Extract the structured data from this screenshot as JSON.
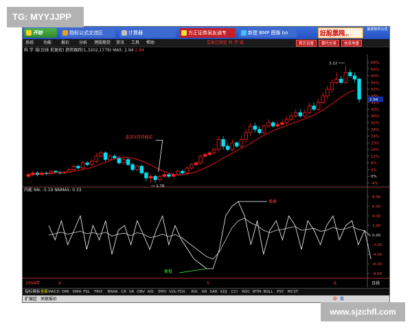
{
  "watermarks": {
    "top_left": "TG: MYYJJPP",
    "bottom_right": "www.sjzchfl.com"
  },
  "taskbar": {
    "start_label": "开始",
    "items": [
      {
        "label": "指标公式交流区"
      },
      {
        "label": "计算器"
      },
      {
        "label": "方正证券泉友通专"
      },
      {
        "label": "新建 BMP 图像 bo"
      }
    ],
    "logo_text": "好股票网",
    "logo_sub": "Goodgupiao.com",
    "tag_text": "股票软件公式"
  },
  "menubar": {
    "items": [
      "系统",
      "功能",
      "报价",
      "分析",
      "港股期货",
      "资讯",
      "工具",
      "帮助"
    ],
    "center_text": "交易已锁定  科 学 城",
    "buttons": [
      "首页设置",
      "委托交易",
      "信息地雷"
    ]
  },
  "chart_title": {
    "stock": "科 学 城(日线 前复权) 趋势跟踪(1,3202,1779)",
    "ma_label": "MA5: 2.94",
    "ma_value": "2.94"
  },
  "main_chart": {
    "axis_right": [
      "68%",
      "64%",
      "60%",
      "56%",
      "52%",
      "48%",
      "44%",
      "40%",
      "36%",
      "32%",
      "28%",
      "24%",
      "20%",
      "16%",
      "12%",
      "8%",
      "4%",
      "0%",
      "-4%"
    ],
    "annotations": {
      "high": "3.22",
      "low": "1.78",
      "current": "2.94",
      "callout": "金叉5日均线买"
    }
  },
  "indicator": {
    "title": "内能 NN: -5.19 NNMA5: 0.33",
    "axis": [
      "8.00",
      "6.00",
      "4.00",
      "2.00",
      "0.00",
      "-2.00",
      "-4.00",
      "-6.00",
      "-8.00"
    ],
    "top_label": "卖高",
    "bottom_label": "卖低"
  },
  "timeline": {
    "left": "2006年",
    "marks": [
      "4",
      "5",
      "6"
    ],
    "right_label": "日线"
  },
  "tabs": {
    "items": [
      "指标",
      "模板",
      "全部",
      "MACD",
      "DMI",
      "DMA",
      "FSL",
      "TRIX",
      "BRAR",
      "CR",
      "VR",
      "OBV",
      "ASI",
      "EMV",
      "VOL-TDX",
      "RSI",
      "KR",
      "SAR",
      "KDJ",
      "CCI",
      "ROC",
      "MTM",
      "BOLL",
      "PSY",
      "MCST"
    ]
  },
  "status": {
    "left": [
      "扩展区",
      "关联报价"
    ],
    "right": [
      "中",
      "英"
    ]
  },
  "colors": {
    "up": "#ff2020",
    "down": "#00e0f0",
    "ma": "#e81818",
    "line1": "#ffffff",
    "line2": "#d8d8d8",
    "annotation": "#ff4040",
    "green_label": "#40ff40"
  },
  "chart_data": [
    {
      "type": "candlestick",
      "title": "科 学 城(日线 前复权)",
      "y_axis": {
        "unit": "percent",
        "range": [
          -6,
          70
        ],
        "ticks": [
          68,
          64,
          60,
          56,
          52,
          48,
          44,
          40,
          36,
          32,
          28,
          24,
          20,
          16,
          12,
          8,
          4,
          0,
          -4
        ]
      },
      "candles": [
        {
          "o": 0,
          "c": 1,
          "h": 2,
          "l": -1
        },
        {
          "o": 1,
          "c": 2,
          "h": 3,
          "l": 0
        },
        {
          "o": 2,
          "c": 1,
          "h": 3,
          "l": 0
        },
        {
          "o": 1,
          "c": 2,
          "h": 3,
          "l": 0
        },
        {
          "o": 2,
          "c": 1.5,
          "h": 3,
          "l": 0.5
        },
        {
          "o": 1.5,
          "c": 3,
          "h": 4,
          "l": 1
        },
        {
          "o": 3,
          "c": 2.5,
          "h": 3.5,
          "l": 1.5
        },
        {
          "o": 2.5,
          "c": 2,
          "h": 3,
          "l": 1
        },
        {
          "o": 2,
          "c": 2.5,
          "h": 3,
          "l": 1.5
        },
        {
          "o": 2.5,
          "c": 4,
          "h": 5,
          "l": 2
        },
        {
          "o": 4,
          "c": 6,
          "h": 7,
          "l": 3
        },
        {
          "o": 6,
          "c": 5,
          "h": 7,
          "l": 4
        },
        {
          "o": 5,
          "c": 8,
          "h": 9,
          "l": 4
        },
        {
          "o": 8,
          "c": 7,
          "h": 9,
          "l": 6
        },
        {
          "o": 7,
          "c": 9,
          "h": 10,
          "l": 6
        },
        {
          "o": 9,
          "c": 12,
          "h": 14,
          "l": 8
        },
        {
          "o": 12,
          "c": 14,
          "h": 15,
          "l": 11
        },
        {
          "o": 14,
          "c": 10,
          "h": 15,
          "l": 9
        },
        {
          "o": 10,
          "c": 12,
          "h": 13,
          "l": 9
        },
        {
          "o": 12,
          "c": 11,
          "h": 13,
          "l": 10
        },
        {
          "o": 11,
          "c": 8,
          "h": 12,
          "l": 7
        },
        {
          "o": 8,
          "c": 10,
          "h": 11,
          "l": 7
        },
        {
          "o": 10,
          "c": 7,
          "h": 11,
          "l": 6
        },
        {
          "o": 7,
          "c": 4,
          "h": 8,
          "l": 3
        },
        {
          "o": 4,
          "c": 6,
          "h": 7,
          "l": 3
        },
        {
          "o": 6,
          "c": 2,
          "h": 7,
          "l": 1
        },
        {
          "o": 2,
          "c": -1,
          "h": 3,
          "l": -3
        },
        {
          "o": -1,
          "c": 0,
          "h": 1,
          "l": -4
        },
        {
          "o": 0,
          "c": -2,
          "h": 1,
          "l": -4
        },
        {
          "o": -2,
          "c": 0,
          "h": 1,
          "l": -3
        },
        {
          "o": 0,
          "c": 1,
          "h": 2,
          "l": -1
        },
        {
          "o": 1,
          "c": 0,
          "h": 2,
          "l": -1
        },
        {
          "o": 0,
          "c": 1,
          "h": 2,
          "l": -1
        },
        {
          "o": 1,
          "c": 3,
          "h": 4,
          "l": 0
        },
        {
          "o": 3,
          "c": 2,
          "h": 4,
          "l": 1
        },
        {
          "o": 2,
          "c": 5,
          "h": 6,
          "l": 1
        },
        {
          "o": 5,
          "c": 7,
          "h": 8,
          "l": 4
        },
        {
          "o": 7,
          "c": 8,
          "h": 9,
          "l": 6
        },
        {
          "o": 8,
          "c": 12,
          "h": 13,
          "l": 7
        },
        {
          "o": 12,
          "c": 13,
          "h": 14,
          "l": 11
        },
        {
          "o": 13,
          "c": 14,
          "h": 15,
          "l": 12
        },
        {
          "o": 14,
          "c": 16,
          "h": 17,
          "l": 13
        },
        {
          "o": 16,
          "c": 22,
          "h": 24,
          "l": 15
        },
        {
          "o": 22,
          "c": 18,
          "h": 24,
          "l": 16
        },
        {
          "o": 18,
          "c": 16,
          "h": 20,
          "l": 15
        },
        {
          "o": 16,
          "c": 20,
          "h": 22,
          "l": 15
        },
        {
          "o": 20,
          "c": 18,
          "h": 21,
          "l": 17
        },
        {
          "o": 18,
          "c": 22,
          "h": 24,
          "l": 17
        },
        {
          "o": 22,
          "c": 26,
          "h": 28,
          "l": 20
        },
        {
          "o": 26,
          "c": 30,
          "h": 32,
          "l": 24
        },
        {
          "o": 30,
          "c": 28,
          "h": 32,
          "l": 26
        },
        {
          "o": 28,
          "c": 26,
          "h": 30,
          "l": 25
        },
        {
          "o": 26,
          "c": 30,
          "h": 31,
          "l": 25
        },
        {
          "o": 30,
          "c": 32,
          "h": 34,
          "l": 29
        },
        {
          "o": 32,
          "c": 30,
          "h": 33,
          "l": 29
        },
        {
          "o": 30,
          "c": 31,
          "h": 33,
          "l": 29
        },
        {
          "o": 31,
          "c": 32,
          "h": 34,
          "l": 30
        },
        {
          "o": 32,
          "c": 34,
          "h": 36,
          "l": 31
        },
        {
          "o": 34,
          "c": 36,
          "h": 38,
          "l": 33
        },
        {
          "o": 36,
          "c": 38,
          "h": 40,
          "l": 35
        },
        {
          "o": 38,
          "c": 36,
          "h": 40,
          "l": 35
        },
        {
          "o": 36,
          "c": 38,
          "h": 40,
          "l": 35
        },
        {
          "o": 38,
          "c": 42,
          "h": 44,
          "l": 37
        },
        {
          "o": 42,
          "c": 40,
          "h": 44,
          "l": 39
        },
        {
          "o": 40,
          "c": 44,
          "h": 46,
          "l": 39
        },
        {
          "o": 44,
          "c": 48,
          "h": 50,
          "l": 43
        },
        {
          "o": 48,
          "c": 52,
          "h": 54,
          "l": 46
        },
        {
          "o": 52,
          "c": 56,
          "h": 58,
          "l": 50
        },
        {
          "o": 56,
          "c": 58,
          "h": 62,
          "l": 55
        },
        {
          "o": 58,
          "c": 56,
          "h": 60,
          "l": 55
        },
        {
          "o": 56,
          "c": 62,
          "h": 66,
          "l": 55
        },
        {
          "o": 62,
          "c": 60,
          "h": 64,
          "l": 59
        },
        {
          "o": 60,
          "c": 58,
          "h": 62,
          "l": 56
        },
        {
          "o": 58,
          "c": 46,
          "h": 59,
          "l": 44
        }
      ],
      "ma": [
        1,
        1.3,
        1.5,
        1.7,
        1.8,
        2,
        2.2,
        2.3,
        2.4,
        2.6,
        3,
        3.4,
        4,
        4.6,
        5.3,
        6.3,
        7.4,
        8.4,
        9.4,
        10.3,
        11,
        11.3,
        11.3,
        10.8,
        10.1,
        9.2,
        8.1,
        6.7,
        5.3,
        4,
        2.9,
        1.9,
        1.2,
        0.9,
        0.9,
        1.3,
        1.9,
        2.7,
        3.8,
        5,
        6.3,
        7.7,
        9.3,
        10.9,
        12.4,
        13.8,
        15.2,
        16.6,
        18.1,
        19.7,
        21.4,
        23,
        24.5,
        25.9,
        27.2,
        28.3,
        29.3,
        30.3,
        31.3,
        32.4,
        33.4,
        34.4,
        35.5,
        36.6,
        38,
        39.6,
        41.4,
        43.3,
        45.3,
        47.2,
        49,
        50.5,
        51.2
      ]
    },
    {
      "type": "line",
      "title": "内能",
      "y_axis": {
        "range": [
          -8,
          8
        ],
        "ticks": [
          8,
          6,
          4,
          2,
          0,
          -2,
          -4,
          -6,
          -8
        ]
      },
      "series": [
        {
          "name": "NN",
          "values": [
            2,
            -1,
            3,
            -2,
            1,
            4,
            -3,
            2,
            -1,
            3,
            -4,
            1,
            2,
            -2,
            3,
            0,
            -3,
            1,
            4,
            -2,
            2,
            -1,
            -3,
            -5,
            -6,
            -7,
            -7,
            -3,
            4,
            6,
            7,
            4,
            -2,
            3,
            -4,
            1,
            3,
            -1,
            4,
            2,
            -3,
            3,
            1,
            -2,
            2,
            4,
            -1,
            2,
            3,
            -2,
            1,
            -5
          ]
        },
        {
          "name": "NNMA5",
          "values": [
            0,
            0.3,
            0.6,
            0.2,
            0.5,
            0.8,
            0.3,
            0.5,
            0.2,
            0.6,
            -0.2,
            0.2,
            0.4,
            -0.1,
            0.5,
            0.2,
            -0.5,
            -0.3,
            0.2,
            -0.3,
            0.1,
            -0.5,
            -1.5,
            -2.5,
            -3.5,
            -4.5,
            -5,
            -3.5,
            -1,
            1.5,
            3,
            3.5,
            2.5,
            2,
            1,
            0.5,
            1,
            1.2,
            1.5,
            1.8,
            1,
            1.2,
            1.4,
            0.8,
            1,
            1.6,
            1.2,
            1.3,
            1.8,
            1.2,
            0.9,
            -0.2
          ]
        }
      ]
    }
  ]
}
